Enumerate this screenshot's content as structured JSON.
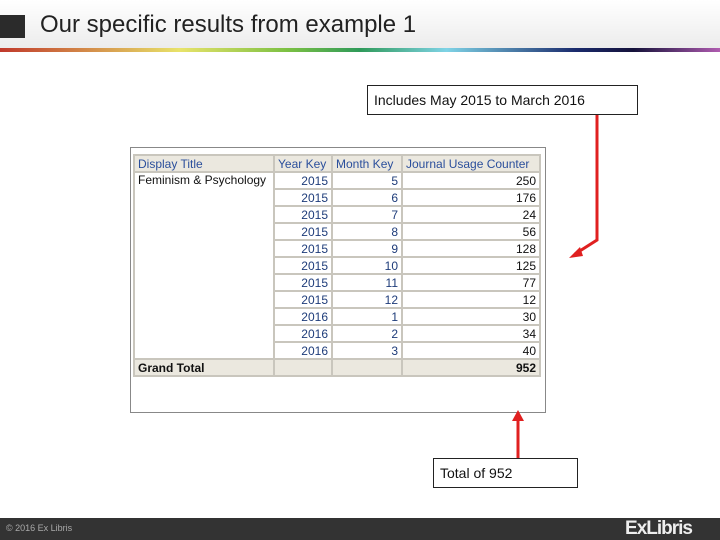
{
  "header": {
    "title": "Our specific results from example 1"
  },
  "callouts": {
    "range": "Includes May 2015 to March 2016",
    "total": "Total of 952"
  },
  "table": {
    "headers": [
      "Display Title",
      "Year Key",
      "Month Key",
      "Journal Usage Counter"
    ],
    "title": "Feminism & Psychology",
    "rows": [
      [
        "2015",
        "5",
        "250"
      ],
      [
        "2015",
        "6",
        "176"
      ],
      [
        "2015",
        "7",
        "24"
      ],
      [
        "2015",
        "8",
        "56"
      ],
      [
        "2015",
        "9",
        "128"
      ],
      [
        "2015",
        "10",
        "125"
      ],
      [
        "2015",
        "11",
        "77"
      ],
      [
        "2015",
        "12",
        "12"
      ],
      [
        "2016",
        "1",
        "30"
      ],
      [
        "2016",
        "2",
        "34"
      ],
      [
        "2016",
        "3",
        "40"
      ]
    ],
    "grand_total_label": "Grand Total",
    "grand_total": "952"
  },
  "footer": {
    "copyright": "© 2016 Ex Libris",
    "logo": "ExLibris"
  },
  "colors": {
    "arrow": "#e02020"
  }
}
